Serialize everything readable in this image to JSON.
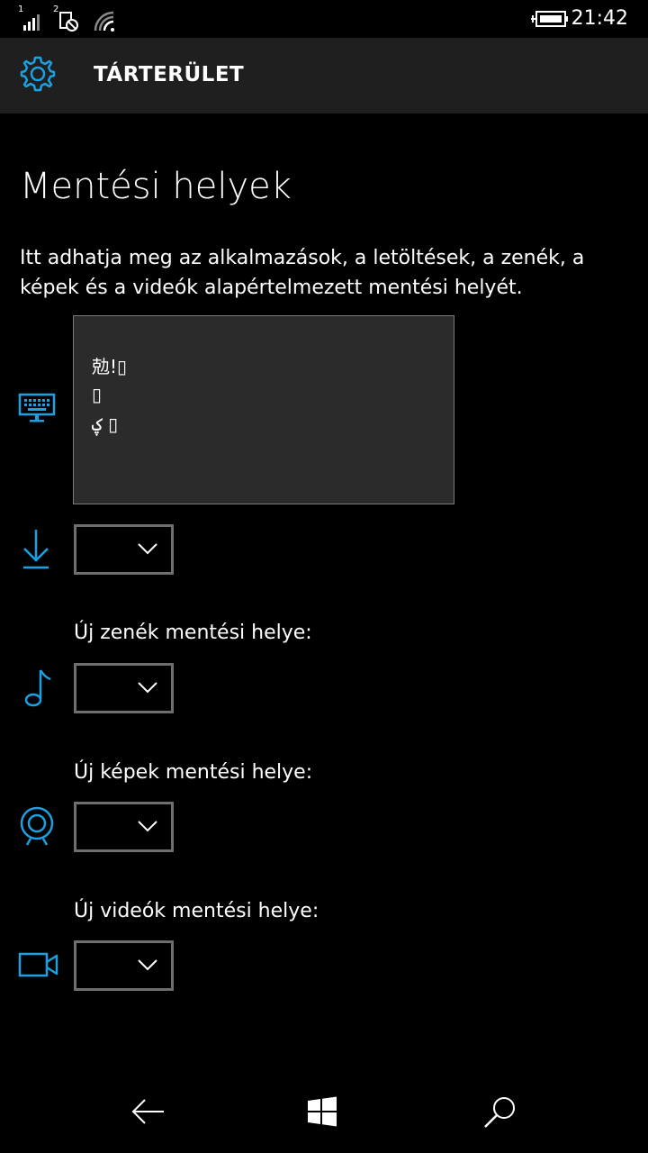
{
  "status": {
    "time": "21:42",
    "sim1": "1",
    "sim2": "2"
  },
  "header": {
    "title": "TÁRTERÜLET",
    "icon": "gear-icon"
  },
  "page": {
    "title": "Mentési helyek",
    "description": "Itt adhatja meg az alkalmazások, a letöltések, a zenék, a képek és a videók alapértelmezett mentési helyét."
  },
  "rows": [
    {
      "icon": "app-icon",
      "label": "",
      "value": ""
    },
    {
      "icon": "download-icon",
      "label": "",
      "value": ""
    },
    {
      "icon": "music-icon",
      "label": "Új zenék mentési helye:",
      "value": ""
    },
    {
      "icon": "camera-icon",
      "label": "Új képek mentési helye:",
      "value": ""
    },
    {
      "icon": "video-icon",
      "label": "Új videók mentési helye:",
      "value": ""
    }
  ],
  "popup": {
    "lines": [
      "勊!▯",
      "▯",
      "ؼ ▯"
    ]
  },
  "colors": {
    "accent": "#1ba1e2",
    "header_bg": "#1f1f1f",
    "popup_bg": "#2b2b2b",
    "dropdown_border": "#6e6e6e"
  }
}
